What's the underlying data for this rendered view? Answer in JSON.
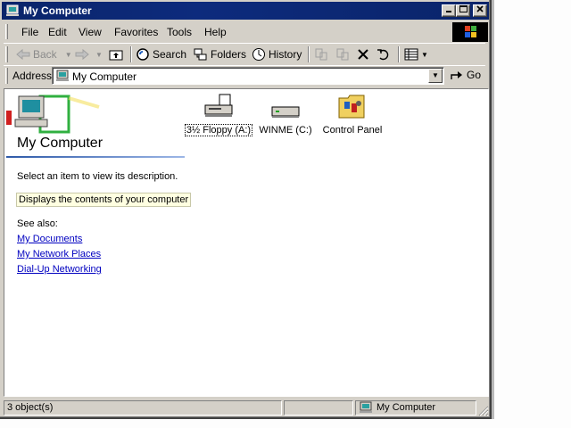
{
  "window": {
    "title": "My Computer"
  },
  "menu": [
    "File",
    "Edit",
    "View",
    "Favorites",
    "Tools",
    "Help"
  ],
  "toolbar": {
    "back": "Back",
    "search": "Search",
    "folders": "Folders",
    "history": "History"
  },
  "address": {
    "label": "Address",
    "value": "My Computer",
    "go": "Go"
  },
  "panel": {
    "heading": "My Computer",
    "description": "Select an item to view its description.",
    "info": "Displays the contents of your computer",
    "see_also": "See also:",
    "links": [
      "My Documents",
      "My Network Places",
      "Dial-Up Networking"
    ]
  },
  "items": [
    {
      "label": "3½ Floppy (A:)",
      "icon": "floppy-drive-icon"
    },
    {
      "label": "WINME (C:)",
      "icon": "hard-drive-icon"
    },
    {
      "label": "Control Panel",
      "icon": "control-panel-folder-icon"
    }
  ],
  "status": {
    "count": "3 object(s)",
    "location": "My Computer"
  },
  "colors": {
    "titlebar": "#0a246a",
    "face": "#d4d0c8",
    "link": "#0000c0"
  }
}
